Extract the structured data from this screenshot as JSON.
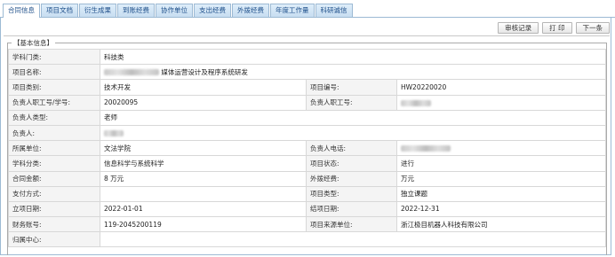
{
  "tabs": [
    {
      "label": "合同信息",
      "active": true
    },
    {
      "label": "项目文档",
      "active": false
    },
    {
      "label": "衍生成果",
      "active": false
    },
    {
      "label": "到账经费",
      "active": false
    },
    {
      "label": "协作单位",
      "active": false
    },
    {
      "label": "支出经费",
      "active": false
    },
    {
      "label": "外拨经费",
      "active": false
    },
    {
      "label": "年度工作量",
      "active": false
    },
    {
      "label": "科研诚信",
      "active": false
    }
  ],
  "toolbar": {
    "audit_label": "审核记录",
    "print_label": "打 印",
    "next_label": "下一条"
  },
  "section": {
    "title": "【基本信息】"
  },
  "fields": {
    "subject_category": {
      "label": "学科门类:",
      "value": "科技类"
    },
    "project_name": {
      "label": "项目名称:",
      "value": "媒体运营设计及程序系统研发"
    },
    "project_type": {
      "label": "项目类别:",
      "value": "技术开发"
    },
    "project_number": {
      "label": "项目编号:",
      "value": "HW20220020"
    },
    "leader_id": {
      "label": "负责人职工号/学号:",
      "value": "20020095"
    },
    "leader_staff_id": {
      "label": "负责人职工号:",
      "value": ""
    },
    "leader_type": {
      "label": "负责人类型:",
      "value": "老师"
    },
    "leader": {
      "label": "负责人:",
      "value": ""
    },
    "unit": {
      "label": "所属单位:",
      "value": "文法学院"
    },
    "leader_phone": {
      "label": "负责人电话:",
      "value": ""
    },
    "discipline": {
      "label": "学科分类:",
      "value": "信息科学与系统科学"
    },
    "project_status": {
      "label": "项目状态:",
      "value": "进行"
    },
    "contract_amount": {
      "label": "合同金额:",
      "value": "8 万元"
    },
    "external_funding": {
      "label": "外拨经费:",
      "value": "万元"
    },
    "payment_method": {
      "label": "支付方式:",
      "value": ""
    },
    "project_kind": {
      "label": "项目类型:",
      "value": "独立课题"
    },
    "start_date": {
      "label": "立项日期:",
      "value": "2022-01-01"
    },
    "end_date": {
      "label": "结项日期:",
      "value": "2022-12-31"
    },
    "account": {
      "label": "财务账号:",
      "value": "119-2045200119"
    },
    "source_unit": {
      "label": "项目来源单位:",
      "value": "浙江极目机器人科技有限公司"
    },
    "center": {
      "label": "归属中心:",
      "value": ""
    }
  }
}
